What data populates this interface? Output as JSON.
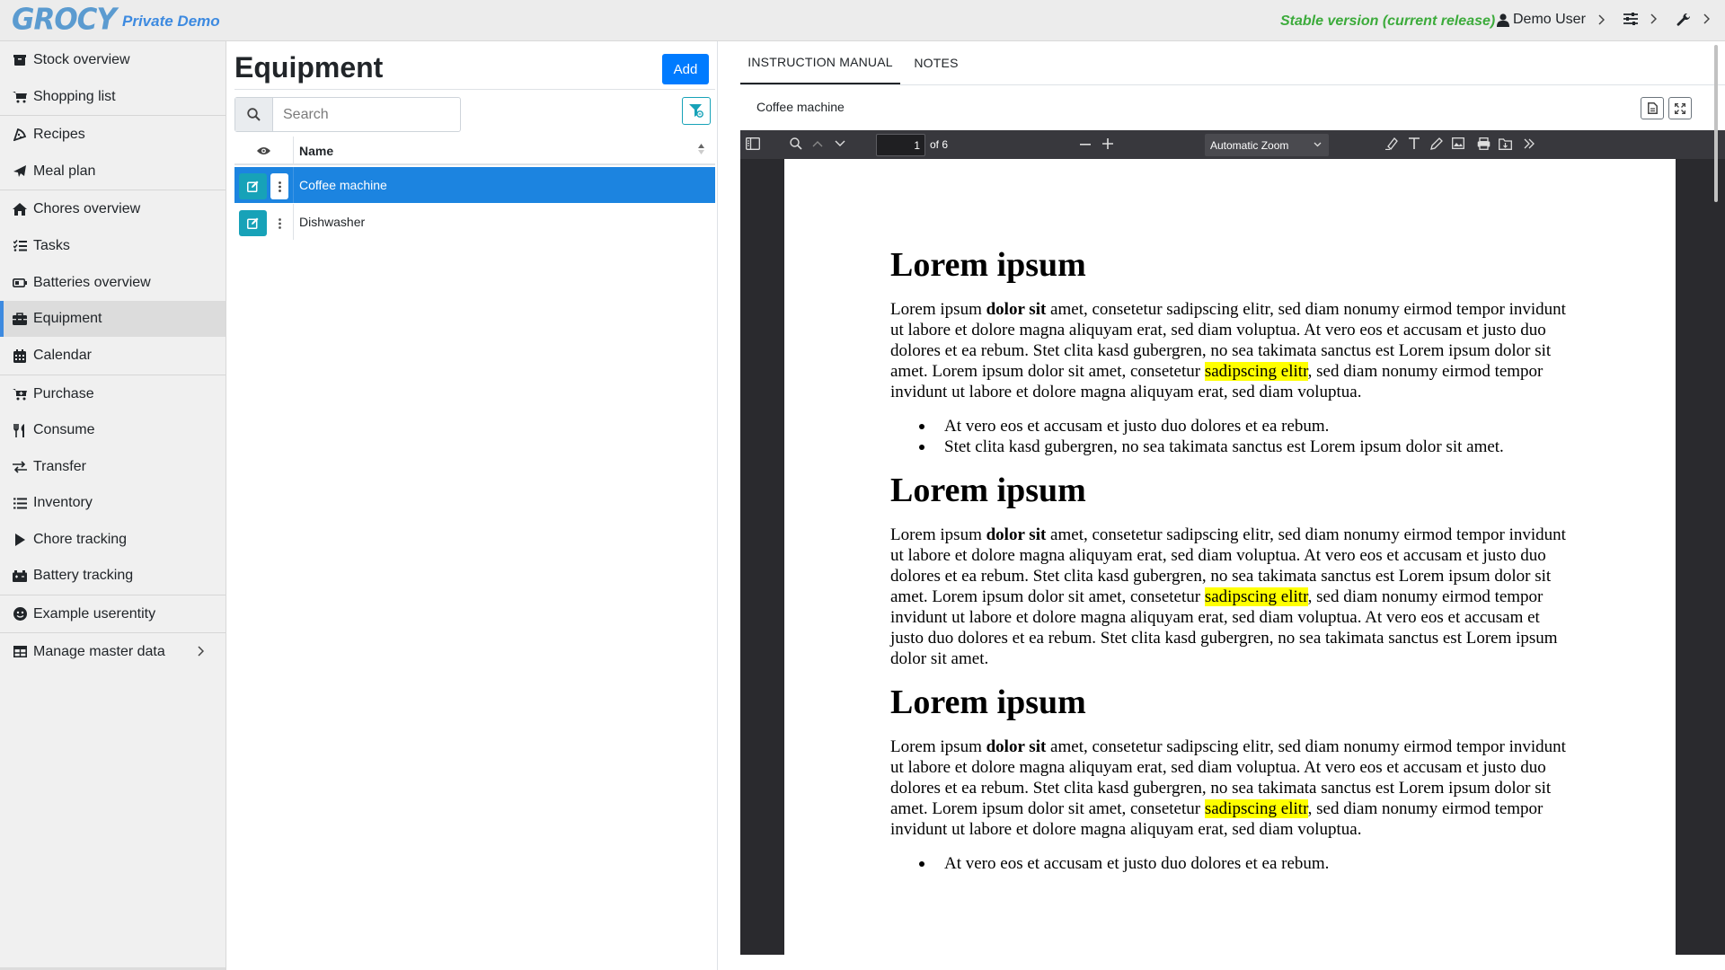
{
  "topbar": {
    "logo": "GROCY",
    "subtitle": "Private Demo",
    "version": "Stable version (current release)",
    "user": "Demo User"
  },
  "sidebar": {
    "items": [
      {
        "label": "Stock overview",
        "icon": "box-icon"
      },
      {
        "label": "Shopping list",
        "icon": "shopping-cart-icon"
      },
      {
        "label": "Recipes",
        "icon": "pizza-slice-icon"
      },
      {
        "label": "Meal plan",
        "icon": "paper-plane-icon"
      },
      {
        "label": "Chores overview",
        "icon": "home-icon"
      },
      {
        "label": "Tasks",
        "icon": "tasks-icon"
      },
      {
        "label": "Batteries overview",
        "icon": "battery-icon"
      },
      {
        "label": "Equipment",
        "icon": "toolbox-icon",
        "active": true
      },
      {
        "label": "Calendar",
        "icon": "calendar-icon"
      },
      {
        "label": "Purchase",
        "icon": "cart-plus-icon"
      },
      {
        "label": "Consume",
        "icon": "utensils-icon"
      },
      {
        "label": "Transfer",
        "icon": "exchange-icon"
      },
      {
        "label": "Inventory",
        "icon": "list-icon"
      },
      {
        "label": "Chore tracking",
        "icon": "play-icon"
      },
      {
        "label": "Battery tracking",
        "icon": "car-battery-icon"
      },
      {
        "label": "Example userentity",
        "icon": "smile-icon"
      },
      {
        "label": "Manage master data",
        "icon": "table-icon"
      }
    ]
  },
  "equipment": {
    "title": "Equipment",
    "add_label": "Add",
    "search_placeholder": "Search",
    "column_name": "Name",
    "rows": [
      {
        "name": "Coffee machine",
        "selected": true
      },
      {
        "name": "Dishwasher",
        "selected": false
      }
    ]
  },
  "detail": {
    "tabs": [
      "INSTRUCTION MANUAL",
      "NOTES"
    ],
    "active_tab": "INSTRUCTION MANUAL",
    "doc_title": "Coffee machine"
  },
  "viewer": {
    "page_number": "1",
    "page_of": "of 6",
    "zoom": "Automatic Zoom",
    "highlight_color": "#ffff00",
    "document": {
      "sections": [
        {
          "heading": "Lorem ipsum",
          "p_start": "Lorem ipsum ",
          "p_bold": "dolor sit",
          "p_mid": " amet, consetetur sadipscing elitr, sed diam nonumy eirmod tempor invidunt ut labore et dolore magna aliquyam erat, sed diam voluptua. At vero eos et accusam et justo duo dolores et ea rebum. Stet clita kasd gubergren, no sea takimata sanctus est Lorem ipsum dolor sit amet. Lorem ipsum dolor sit amet, consetetur ",
          "p_highlight": "sadipscing elitr",
          "p_end": ", sed diam nonumy eirmod tempor invidunt ut labore et dolore magna aliquyam erat, sed diam voluptua.",
          "bullets": [
            "At vero eos et accusam et justo duo dolores et ea rebum.",
            "Stet clita kasd gubergren, no sea takimata sanctus est Lorem ipsum dolor sit amet."
          ]
        },
        {
          "heading": "Lorem ipsum",
          "p_start": "Lorem ipsum ",
          "p_bold": "dolor sit",
          "p_mid": " amet, consetetur sadipscing elitr, sed diam nonumy eirmod tempor invidunt ut labore et dolore magna aliquyam erat, sed diam voluptua. At vero eos et accusam et justo duo dolores et ea rebum. Stet clita kasd gubergren, no sea takimata sanctus est Lorem ipsum dolor sit amet. Lorem ipsum dolor sit amet, consetetur ",
          "p_highlight": "sadipscing elitr",
          "p_end": ", sed diam nonumy eirmod tempor invidunt ut labore et dolore magna aliquyam erat, sed diam voluptua. At vero eos et accusam et justo duo dolores et ea rebum. Stet clita kasd gubergren, no sea takimata sanctus est Lorem ipsum dolor sit amet."
        },
        {
          "heading": "Lorem ipsum",
          "p_start": "Lorem ipsum ",
          "p_bold": "dolor sit",
          "p_mid": " amet, consetetur sadipscing elitr, sed diam nonumy eirmod tempor invidunt ut labore et dolore magna aliquyam erat, sed diam voluptua. At vero eos et accusam et justo duo dolores et ea rebum. Stet clita kasd gubergren, no sea takimata sanctus est Lorem ipsum dolor sit amet. Lorem ipsum dolor sit amet, consetetur ",
          "p_highlight": "sadipscing elitr",
          "p_end": ", sed diam nonumy eirmod tempor invidunt ut labore et dolore magna aliquyam erat, sed diam voluptua.",
          "bullets": [
            "At vero eos et accusam et justo duo dolores et ea rebum."
          ]
        }
      ]
    }
  },
  "colors": {
    "primary": "#007bff",
    "info": "#17a2b8",
    "selected_row": "#1c84e0",
    "brand": "#3d8ae0",
    "version_green": "#3cab3b"
  }
}
